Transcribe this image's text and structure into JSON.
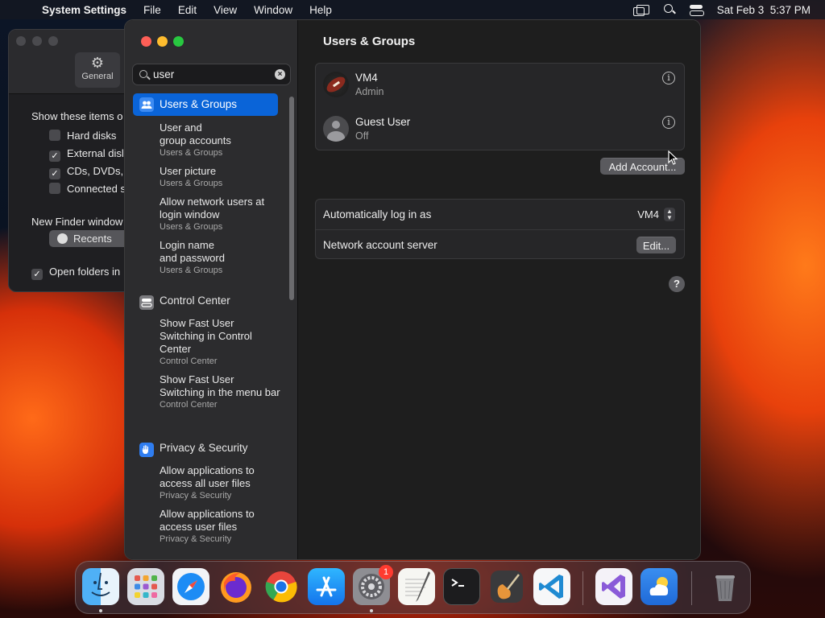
{
  "menubar": {
    "apple": "",
    "app": "System Settings",
    "menus": [
      "File",
      "Edit",
      "View",
      "Window",
      "Help"
    ],
    "datetime": "Sat Feb 3  5:37 PM",
    "status_icons": [
      "screen-mirroring-icon",
      "spotlight-search-icon",
      "control-center-icon"
    ]
  },
  "finder_window": {
    "tab_general": "General",
    "show_items_label": "Show these items o",
    "items": [
      {
        "label": "Hard disks",
        "checked": false
      },
      {
        "label": "External disl",
        "checked": true
      },
      {
        "label": "CDs, DVDs,",
        "checked": true
      },
      {
        "label": "Connected s",
        "checked": false
      }
    ],
    "new_window_label": "New Finder window",
    "new_window_value": "Recents",
    "open_folders_label": "Open folders in",
    "check_mark": "✓"
  },
  "sidebar": {
    "search_value": "user",
    "search_clear": "×",
    "selected": "Users & Groups",
    "results": [
      {
        "label": "User and\ngroup accounts",
        "category": "Users & Groups"
      },
      {
        "label": "User picture",
        "category": "Users & Groups"
      },
      {
        "label": "Allow network users at login window",
        "category": "Users & Groups"
      },
      {
        "label": "Login name\nand password",
        "category": "Users & Groups"
      }
    ],
    "control_center": {
      "label": "Control Center",
      "results": [
        {
          "label": "Show Fast User Switching in Control Center",
          "category": "Control Center"
        },
        {
          "label": "Show Fast User Switching in the menu bar",
          "category": "Control Center"
        }
      ]
    },
    "privacy": {
      "label": "Privacy & Security",
      "results": [
        {
          "label": "Allow applications to access all user files",
          "category": "Privacy & Security"
        },
        {
          "label": "Allow applications to access user files",
          "category": "Privacy & Security"
        }
      ]
    }
  },
  "content": {
    "title": "Users & Groups",
    "accounts": [
      {
        "name": "VM4",
        "role": "Admin",
        "avatar": "football-avatar"
      },
      {
        "name": "Guest User",
        "role": "Off",
        "avatar": "guest-avatar"
      }
    ],
    "info_glyph": "i",
    "add_account": "Add Account...",
    "auto_login_label": "Automatically log in as",
    "auto_login_value": "VM4",
    "stepper": "⌃⌄",
    "network_server_label": "Network account server",
    "edit_button": "Edit...",
    "help": "?"
  },
  "dock": {
    "apps": [
      "Finder",
      "Launchpad",
      "Safari",
      "Firefox",
      "Chrome",
      "App Store",
      "System Settings",
      "TextEdit",
      "Terminal",
      "GarageBand",
      "Visual Studio Code",
      "Visual Studio",
      "Weather",
      "Trash"
    ],
    "settings_badge": "1"
  },
  "colors": {
    "accent": "#0a64d8",
    "red": "#fe5f57",
    "yellow": "#febc2e",
    "green": "#28c840"
  }
}
